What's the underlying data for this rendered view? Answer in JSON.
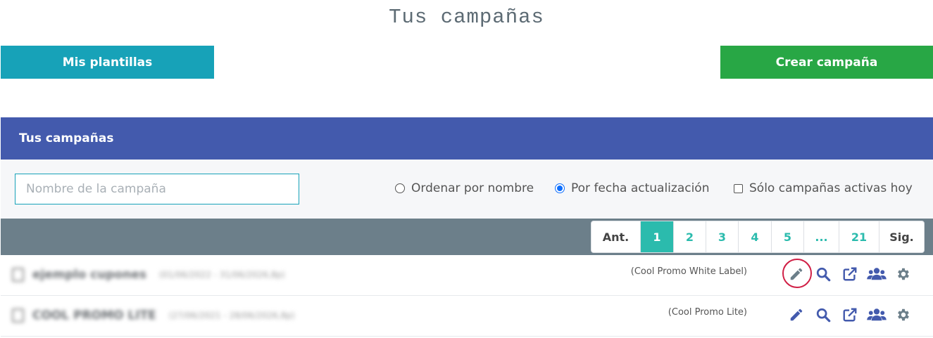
{
  "page_title": "Tus campañas",
  "buttons": {
    "templates_label": "Mis plantillas",
    "create_label": "Crear campaña"
  },
  "panel": {
    "header": "Tus campañas"
  },
  "filters": {
    "search_placeholder": "Nombre de la campaña",
    "sort_by_name": "Ordenar por nombre",
    "sort_by_date": "Por fecha actualización",
    "only_active_today": "Sólo campañas activas hoy",
    "selected_sort": "date"
  },
  "pagination": {
    "prev": "Ant.",
    "pages": [
      "1",
      "2",
      "3",
      "4",
      "5",
      "...",
      "21"
    ],
    "next": "Sig.",
    "active_page": "1"
  },
  "campaigns": [
    {
      "name": "ejemplo cupones",
      "dates": "(01/06/2022 - 31/06/2026,8p)",
      "plan": "(Cool Promo White Label)"
    },
    {
      "name": "COOL PROMO LITE",
      "dates": "(27/06/2021 - 28/06/2026,8p)",
      "plan": "(Cool Promo Lite)"
    }
  ],
  "colors": {
    "teal": "#17a2b8",
    "green": "#28a745",
    "header_blue": "#435aad",
    "pager_bar": "#6c7f8a",
    "pager_active": "#2bbbad",
    "action_icon": "#435aad",
    "gear_icon": "#6c7f8a",
    "highlight": "#d01f45"
  },
  "icons": [
    "calendar-icon",
    "pencil-icon",
    "search-icon",
    "external-link-icon",
    "users-icon",
    "gear-icon"
  ]
}
